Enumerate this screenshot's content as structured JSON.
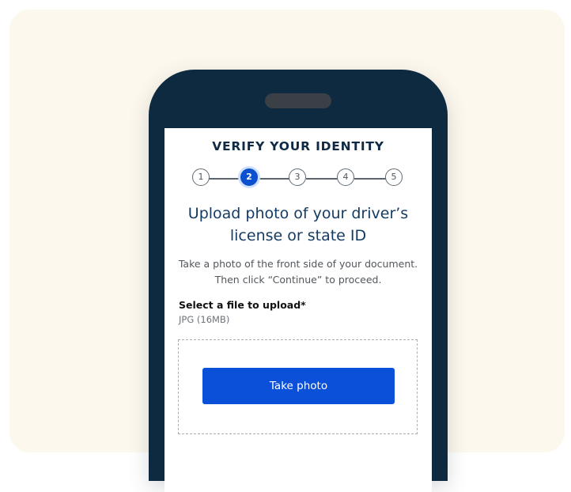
{
  "header": {
    "title": "VERIFY YOUR IDENTITY"
  },
  "stepper": {
    "steps": [
      "1",
      "2",
      "3",
      "4",
      "5"
    ],
    "current": 2
  },
  "main": {
    "heading": "Upload photo of your driver’s license or state ID",
    "description": "Take a photo of the front side of your document. Then click “Continue” to proceed.",
    "upload_label": "Select a file to upload*",
    "upload_hint": "JPG (16MB)",
    "button_label": "Take photo"
  },
  "colors": {
    "accent": "#0b50d9",
    "phone_frame": "#0d2a40",
    "background": "#fdf8ee",
    "heading_text": "#143b63"
  }
}
